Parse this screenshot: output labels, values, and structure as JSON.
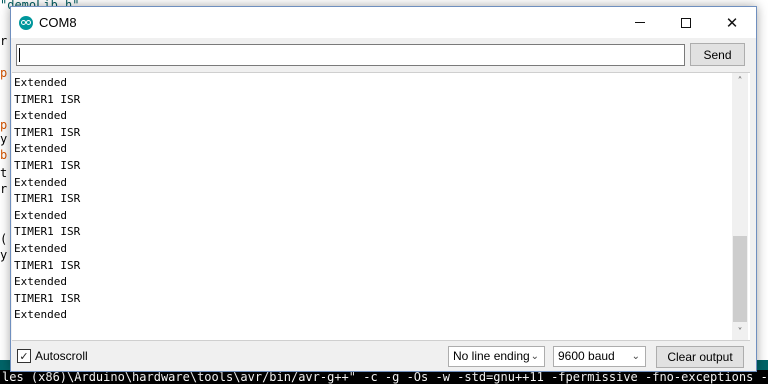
{
  "background_editor": {
    "lines": [
      {
        "text": "\"demoLib.h\"",
        "color": "#005c5f"
      },
      {
        "text": "r",
        "color": "#000000"
      },
      {
        "text": "p",
        "color": "#d35400"
      },
      {
        "text": "p",
        "color": "#d35400"
      },
      {
        "text": "y",
        "color": "#000000"
      },
      {
        "text": "b",
        "color": "#d35400"
      },
      {
        "text": "t",
        "color": "#000000"
      },
      {
        "text": "r",
        "color": "#000000"
      },
      {
        "text": "(",
        "color": "#000000"
      },
      {
        "text": "y",
        "color": "#000000"
      }
    ],
    "console_line": "les (x86)\\Arduino\\hardware\\tools\\avr/bin/avr-g++\" -c -g -Os -w -std=gnu++11 -fpermissive -fno-exceptions -ffunct"
  },
  "window": {
    "title": "COM8",
    "app_icon": "arduino-logo-icon",
    "controls": {
      "minimize": "minimize-icon",
      "maximize": "maximize-icon",
      "close": "close-icon",
      "close_glyph": "✕"
    }
  },
  "send_bar": {
    "input_value": "",
    "send_label": "Send"
  },
  "output": {
    "lines": [
      "Extended",
      "TIMER1 ISR",
      "Extended",
      "TIMER1 ISR",
      "Extended",
      "TIMER1 ISR",
      "Extended",
      "TIMER1 ISR",
      "Extended",
      "TIMER1 ISR",
      "Extended",
      "TIMER1 ISR",
      "Extended",
      "TIMER1 ISR",
      "Extended"
    ]
  },
  "scrollbar": {
    "up_glyph": "˄",
    "down_glyph": "˅"
  },
  "footer": {
    "autoscroll_label": "Autoscroll",
    "autoscroll_checked": true,
    "check_glyph": "✓",
    "line_ending_value": "No line ending",
    "baud_value": "9600 baud",
    "chevron_glyph": "⌄",
    "clear_label": "Clear output"
  },
  "colors": {
    "arduino_teal": "#00979c",
    "console_strip": "#006468"
  }
}
